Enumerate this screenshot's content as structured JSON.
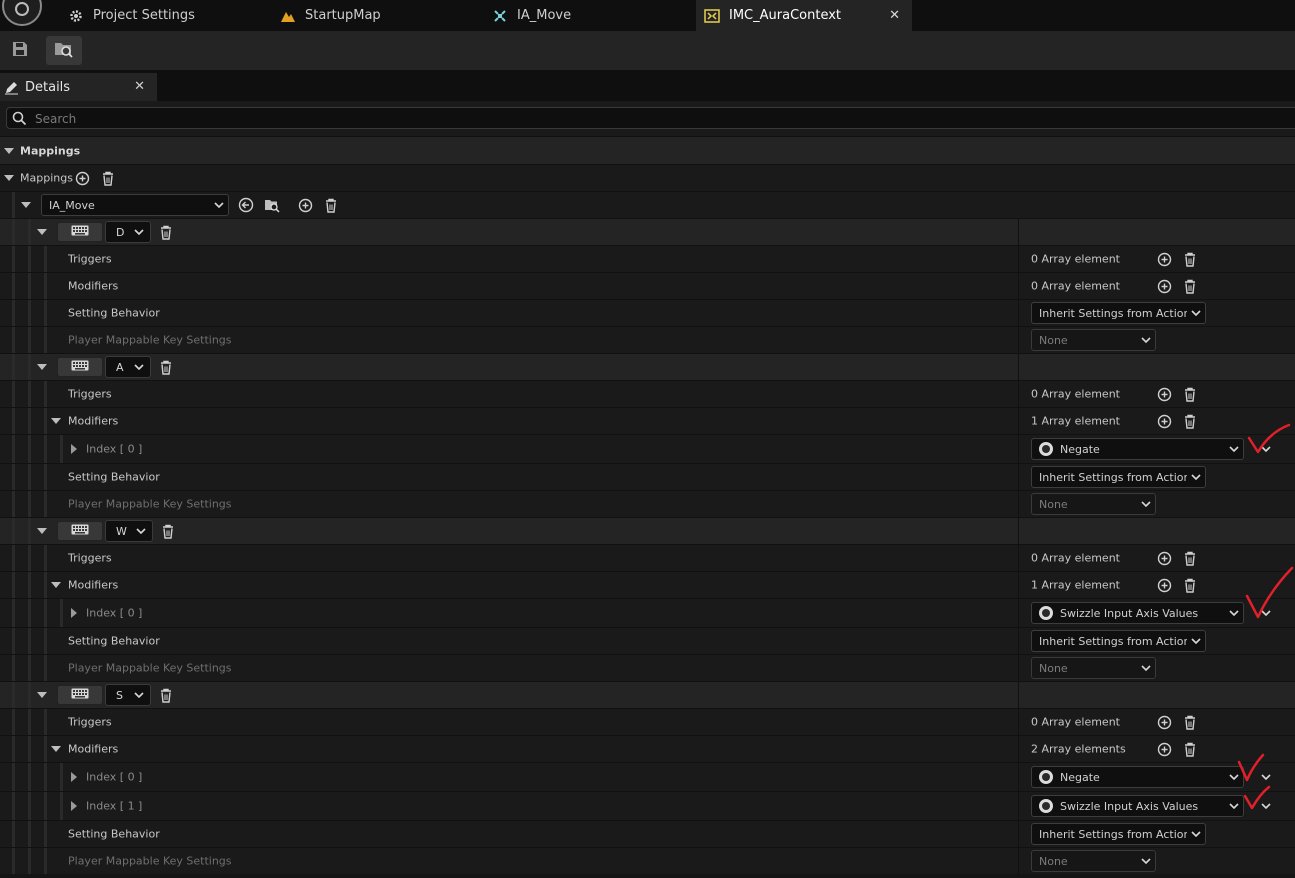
{
  "tabs": [
    {
      "label": "Project Settings",
      "icon": "gear-icon"
    },
    {
      "label": "StartupMap",
      "icon": "map-icon"
    },
    {
      "label": "IA_Move",
      "icon": "input-action-icon"
    },
    {
      "label": "IMC_AuraContext",
      "icon": "input-mapping-context-icon",
      "active": true
    }
  ],
  "toolbar": {
    "save_icon": "save-icon",
    "browse_icon": "browse-to-asset-icon"
  },
  "panel": {
    "title": "Details"
  },
  "search": {
    "placeholder": "Search"
  },
  "category": {
    "label": "Mappings"
  },
  "mappings_array": {
    "label": "Mappings"
  },
  "action": {
    "value": "IA_Move"
  },
  "common": {
    "triggers_label": "Triggers",
    "modifiers_label": "Modifiers",
    "setting_behavior_label": "Setting Behavior",
    "player_mappable_label": "Player Mappable Key Settings",
    "setting_behavior_value": "Inherit Settings from Action",
    "player_mappable_value": "None",
    "index0_label": "Index [ 0 ]",
    "index1_label": "Index [ 1 ]"
  },
  "keys": [
    {
      "key": "D",
      "triggers": "0 Array element",
      "modifiers": "0 Array element",
      "modifier_items": []
    },
    {
      "key": "A",
      "triggers": "0 Array element",
      "modifiers": "1 Array element",
      "modifier_items": [
        "Negate"
      ]
    },
    {
      "key": "W",
      "triggers": "0 Array element",
      "modifiers": "1 Array element",
      "modifier_items": [
        "Swizzle Input Axis Values"
      ]
    },
    {
      "key": "S",
      "triggers": "0 Array element",
      "modifiers": "2 Array elements",
      "modifier_items": [
        "Negate",
        "Swizzle Input Axis Values"
      ]
    }
  ],
  "colors": {
    "annotation_red": "#e0202a",
    "background": "#151515",
    "row_band": "#242424"
  }
}
